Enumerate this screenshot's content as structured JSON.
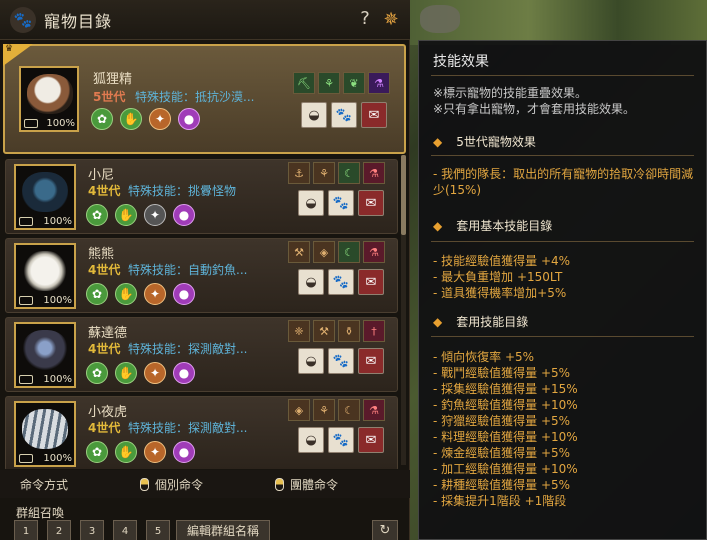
{
  "window": {
    "title": "寵物目錄",
    "help": "?"
  },
  "pets": [
    {
      "name": "狐狸精",
      "generation": "5世代",
      "special_skill": "特殊技能：抵抗沙漠...",
      "percent": "100%",
      "skill_icons": [
        "pickaxe-icon",
        "sickle-icon",
        "leaf-icon",
        "potion-icon"
      ]
    },
    {
      "name": "小尼",
      "generation": "4世代",
      "special_skill": "特殊技能：挑釁怪物",
      "percent": "100%",
      "skill_icons": [
        "fishing-rod-icon",
        "gather-icon",
        "sickle-icon",
        "potion-icon"
      ]
    },
    {
      "name": "熊熊",
      "generation": "4世代",
      "special_skill": "特殊技能：自動釣魚...",
      "percent": "100%",
      "skill_icons": [
        "hammer-icon",
        "hide-icon",
        "sickle-icon",
        "potion-icon"
      ]
    },
    {
      "name": "蘇達德",
      "generation": "4世代",
      "special_skill": "特殊技能：探測敵對...",
      "percent": "100%",
      "skill_icons": [
        "wheat-icon",
        "hammer-icon",
        "flask-icon",
        "sword-icon"
      ]
    },
    {
      "name": "小夜虎",
      "generation": "4世代",
      "special_skill": "特殊技能：探測敵對...",
      "percent": "100%",
      "skill_icons": [
        "hide-icon",
        "gather-icon",
        "sickle-icon",
        "potion-icon"
      ]
    }
  ],
  "command": {
    "label": "命令方式",
    "individual": "個別命令",
    "group": "團體命令"
  },
  "group_summon": {
    "label": "群組召喚",
    "buttons": [
      "1",
      "2",
      "3",
      "4",
      "5"
    ],
    "rename": "編輯群組名稱"
  },
  "tooltip": {
    "title": "技能效果",
    "notes": [
      "※標示寵物的技能重疊效果。",
      "※只有拿出寵物，才會套用技能效果。"
    ],
    "sec1_title": "5世代寵物效果",
    "sec1_lines": [
      "- 我們的隊長：取出的所有寵物的拾取冷卻時間減少(15%)"
    ],
    "sec2_title": "套用基本技能目錄",
    "sec2_lines": [
      "- 技能經驗值獲得量 +4%",
      "- 最大負重增加 +150LT",
      "- 道具獲得機率增加+5%"
    ],
    "sec3_title": "套用技能目錄",
    "sec3_lines": [
      "- 傾向恢復率 +5%",
      "- 戰鬥經驗值獲得量 +5%",
      "- 採集經驗值獲得量 +15%",
      "- 釣魚經驗值獲得量 +10%",
      "- 狩獵經驗值獲得量 +5%",
      "- 料理經驗值獲得量 +10%",
      "- 煉金經驗值獲得量 +5%",
      "- 加工經驗值獲得量 +10%",
      "- 耕種經驗值獲得量 +5%",
      "- 採集提升1階段 +1階段"
    ]
  }
}
